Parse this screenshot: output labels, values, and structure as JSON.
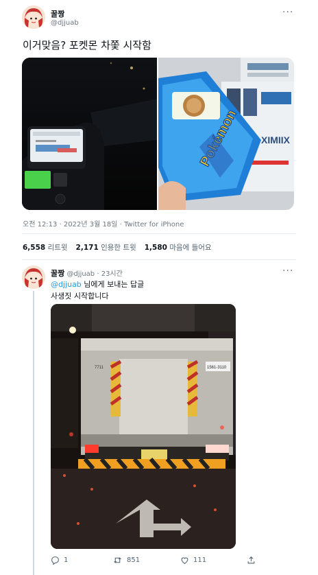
{
  "main_tweet": {
    "author": {
      "name": "꿀짱",
      "handle": "@djjuab"
    },
    "text": "이거맞음? 포켓몬 차쫓 시작함",
    "images": [
      {
        "icon": "car-dashboard-night-photo"
      },
      {
        "icon": "pokemon-bread-package-photo",
        "package_text": "Pokémon",
        "side_text": "XIMIIX"
      }
    ],
    "timestamp": "오전 12:13 · 2022년 3월 18일 · Twitter for iPhone",
    "stats": [
      {
        "count": "6,558",
        "label": "리트윗"
      },
      {
        "count": "2,171",
        "label": "인용한 트윗"
      },
      {
        "count": "1,580",
        "label": "마음에 들어요"
      }
    ]
  },
  "reply_tweet": {
    "author": {
      "name": "꿀짱",
      "handle": "@djjuab",
      "time": "· 23시간"
    },
    "replying_to_handle": "@djjuab",
    "replying_to_suffix": "님에게 보내는 답글",
    "text": "사생짓 시작합니다",
    "image": {
      "icon": "truck-rear-night-photo",
      "plate_text": "1561-3110"
    },
    "actions": [
      {
        "icon": "reply-icon",
        "count": "1"
      },
      {
        "icon": "retweet-icon",
        "count": "851"
      },
      {
        "icon": "heart-icon",
        "count": "111"
      },
      {
        "icon": "share-icon",
        "count": ""
      }
    ]
  },
  "colors": {
    "accent": "#1d9bf0",
    "secondary_text": "#536471",
    "divider": "#e6ecf0"
  }
}
